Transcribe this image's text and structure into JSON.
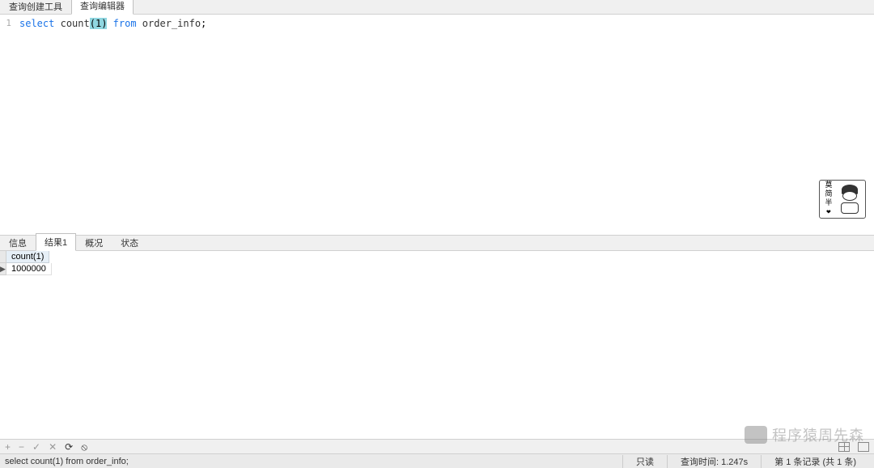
{
  "top_tabs": {
    "builder": "查询创建工具",
    "editor": "查询编辑器"
  },
  "editor": {
    "line_number": "1",
    "keyword_select": "select",
    "func_count": "count",
    "paren_open": "(",
    "arg": "1",
    "paren_close": ")",
    "keyword_from": "from",
    "table": "order_info",
    "terminator": ";"
  },
  "sticker": {
    "line1": "莫",
    "line2": "简",
    "line3": "半",
    "heart": "❤"
  },
  "result_tabs": {
    "info": "信息",
    "result1": "结果1",
    "summary": "概况",
    "status": "状态"
  },
  "result": {
    "columns": [
      "count(1)"
    ],
    "rows": [
      [
        "1000000"
      ]
    ]
  },
  "toolbar": {
    "add": "+",
    "remove": "−",
    "check": "✓",
    "cancel": "✕",
    "refresh": "⟳",
    "stop": "⦸"
  },
  "status": {
    "query": "select count(1) from order_info;",
    "readonly": "只读",
    "time": "查询时间: 1.247s",
    "records": "第 1 条记录 (共 1 条)"
  },
  "watermark": {
    "text": "程序猿周先森"
  }
}
